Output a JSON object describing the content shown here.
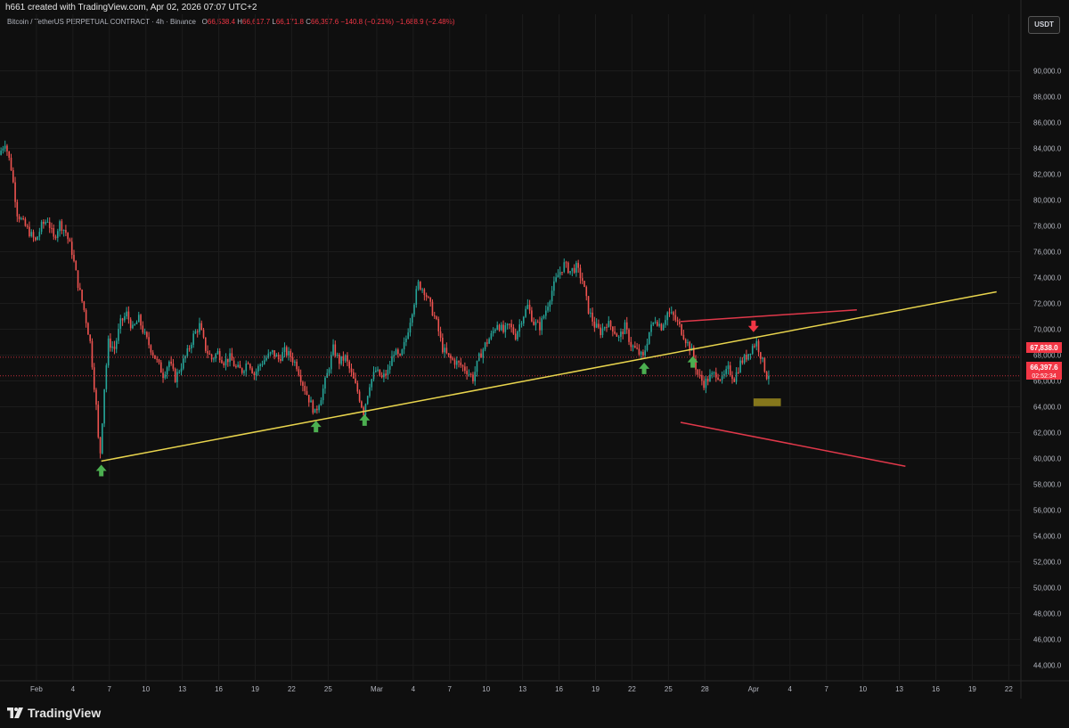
{
  "header": {
    "author_line": "h661 created with TradingView.com, Apr 02, 2026 07:07 UTC+2",
    "symbol": "Bitcoin / TetherUS PERPETUAL CONTRACT · 4h · Binance",
    "ohlc": [
      {
        "key": "O",
        "value": "66,538.4"
      },
      {
        "key": "H",
        "value": "66,617.7"
      },
      {
        "key": "L",
        "value": "66,171.8"
      },
      {
        "key": "C",
        "value": "66,397.6"
      }
    ],
    "change": "−140.8 (−0.21%)",
    "change2": "−1,688.9 (−2.48%)",
    "currency_button": "USDT"
  },
  "price_labels": {
    "level_label": "67,838.0",
    "last_price": "66,397.6",
    "countdown": "02:52:34"
  },
  "chart_data": {
    "type": "candlestick",
    "title": "Bitcoin / TetherUS PERPETUAL CONTRACT · 4h · Binance",
    "ylim": [
      42800,
      93000
    ],
    "xlim": [
      "2026-01-29",
      "2026-04-23"
    ],
    "y_ticks": [
      44000,
      46000,
      48000,
      50000,
      52000,
      54000,
      56000,
      58000,
      60000,
      62000,
      64000,
      66000,
      68000,
      70000,
      72000,
      74000,
      76000,
      78000,
      80000,
      82000,
      84000,
      86000,
      88000,
      90000
    ],
    "y_tick_labels": [
      "44,000.0",
      "46,000.0",
      "48,000.0",
      "50,000.0",
      "52,000.0",
      "54,000.0",
      "56,000.0",
      "58,000.0",
      "60,000.0",
      "62,000.0",
      "64,000.0",
      "66,000.0",
      "68,000.0",
      "70,000.0",
      "72,000.0",
      "74,000.0",
      "76,000.0",
      "78,000.0",
      "80,000.0",
      "82,000.0",
      "84,000.0",
      "86,000.0",
      "88,000.0",
      "90,000.0"
    ],
    "x_ticks": [
      {
        "date": "2026-02-01",
        "label": "Feb"
      },
      {
        "date": "2026-02-04",
        "label": "4"
      },
      {
        "date": "2026-02-07",
        "label": "7"
      },
      {
        "date": "2026-02-10",
        "label": "10"
      },
      {
        "date": "2026-02-13",
        "label": "13"
      },
      {
        "date": "2026-02-16",
        "label": "16"
      },
      {
        "date": "2026-02-19",
        "label": "19"
      },
      {
        "date": "2026-02-22",
        "label": "22"
      },
      {
        "date": "2026-02-25",
        "label": "25"
      },
      {
        "date": "2026-03-01",
        "label": "Mar"
      },
      {
        "date": "2026-03-04",
        "label": "4"
      },
      {
        "date": "2026-03-07",
        "label": "7"
      },
      {
        "date": "2026-03-10",
        "label": "10"
      },
      {
        "date": "2026-03-13",
        "label": "13"
      },
      {
        "date": "2026-03-16",
        "label": "16"
      },
      {
        "date": "2026-03-19",
        "label": "19"
      },
      {
        "date": "2026-03-22",
        "label": "22"
      },
      {
        "date": "2026-03-25",
        "label": "25"
      },
      {
        "date": "2026-03-28",
        "label": "28"
      },
      {
        "date": "2026-04-01",
        "label": "Apr"
      },
      {
        "date": "2026-04-04",
        "label": "4"
      },
      {
        "date": "2026-04-07",
        "label": "7"
      },
      {
        "date": "2026-04-10",
        "label": "10"
      },
      {
        "date": "2026-04-13",
        "label": "13"
      },
      {
        "date": "2026-04-16",
        "label": "16"
      },
      {
        "date": "2026-04-19",
        "label": "19"
      },
      {
        "date": "2026-04-22",
        "label": "22"
      }
    ],
    "price_path": [
      [
        "2026-01-29 00:00",
        83500
      ],
      [
        "2026-01-29 12:00",
        84500
      ],
      [
        "2026-01-30 00:00",
        82500
      ],
      [
        "2026-01-30 12:00",
        79000
      ],
      [
        "2026-01-31 00:00",
        78200
      ],
      [
        "2026-01-31 12:00",
        77500
      ],
      [
        "2026-02-01 00:00",
        76800
      ],
      [
        "2026-02-01 12:00",
        78000
      ],
      [
        "2026-02-02 00:00",
        78500
      ],
      [
        "2026-02-02 12:00",
        77000
      ],
      [
        "2026-02-03 00:00",
        78200
      ],
      [
        "2026-02-03 12:00",
        77500
      ],
      [
        "2026-02-04 00:00",
        76000
      ],
      [
        "2026-02-04 12:00",
        73500
      ],
      [
        "2026-02-05 00:00",
        71500
      ],
      [
        "2026-02-05 12:00",
        69000
      ],
      [
        "2026-02-06 00:00",
        64000
      ],
      [
        "2026-02-06 04:00",
        61500
      ],
      [
        "2026-02-06 08:00",
        60500
      ],
      [
        "2026-02-06 16:00",
        65500
      ],
      [
        "2026-02-07 00:00",
        69000
      ],
      [
        "2026-02-07 12:00",
        68500
      ],
      [
        "2026-02-08 00:00",
        70500
      ],
      [
        "2026-02-08 12:00",
        71200
      ],
      [
        "2026-02-09 00:00",
        70000
      ],
      [
        "2026-02-09 12:00",
        70800
      ],
      [
        "2026-02-10 00:00",
        69500
      ],
      [
        "2026-02-10 12:00",
        68500
      ],
      [
        "2026-02-11 00:00",
        67500
      ],
      [
        "2026-02-11 12:00",
        66500
      ],
      [
        "2026-02-12 00:00",
        67500
      ],
      [
        "2026-02-12 12:00",
        66200
      ],
      [
        "2026-02-13 00:00",
        67200
      ],
      [
        "2026-02-13 12:00",
        68200
      ],
      [
        "2026-02-14 00:00",
        69500
      ],
      [
        "2026-02-14 12:00",
        70300
      ],
      [
        "2026-02-15 00:00",
        68500
      ],
      [
        "2026-02-15 12:00",
        67700
      ],
      [
        "2026-02-16 00:00",
        68200
      ],
      [
        "2026-02-16 12:00",
        67500
      ],
      [
        "2026-02-17 00:00",
        67800
      ],
      [
        "2026-02-17 12:00",
        67000
      ],
      [
        "2026-02-18 00:00",
        66800
      ],
      [
        "2026-02-18 12:00",
        67600
      ],
      [
        "2026-02-19 00:00",
        66500
      ],
      [
        "2026-02-19 12:00",
        67300
      ],
      [
        "2026-02-20 00:00",
        67800
      ],
      [
        "2026-02-20 12:00",
        68200
      ],
      [
        "2026-02-21 00:00",
        67700
      ],
      [
        "2026-02-21 12:00",
        68300
      ],
      [
        "2026-02-22 00:00",
        67900
      ],
      [
        "2026-02-22 12:00",
        67200
      ],
      [
        "2026-02-23 00:00",
        65800
      ],
      [
        "2026-02-23 12:00",
        64600
      ],
      [
        "2026-02-24 00:00",
        63500
      ],
      [
        "2026-02-24 12:00",
        64800
      ],
      [
        "2026-02-25 00:00",
        66500
      ],
      [
        "2026-02-25 12:00",
        68500
      ],
      [
        "2026-02-26 00:00",
        67500
      ],
      [
        "2026-02-26 12:00",
        67800
      ],
      [
        "2026-02-27 00:00",
        66500
      ],
      [
        "2026-02-27 12:00",
        65200
      ],
      [
        "2026-02-28 00:00",
        63600
      ],
      [
        "2026-02-28 12:00",
        65800
      ],
      [
        "2026-03-01 00:00",
        66800
      ],
      [
        "2026-03-01 12:00",
        66200
      ],
      [
        "2026-03-02 00:00",
        66700
      ],
      [
        "2026-03-02 12:00",
        68300
      ],
      [
        "2026-03-03 00:00",
        67700
      ],
      [
        "2026-03-03 12:00",
        69300
      ],
      [
        "2026-03-04 00:00",
        71500
      ],
      [
        "2026-03-04 12:00",
        73500
      ],
      [
        "2026-03-05 00:00",
        73000
      ],
      [
        "2026-03-05 12:00",
        71800
      ],
      [
        "2026-03-06 00:00",
        70500
      ],
      [
        "2026-03-06 12:00",
        68500
      ],
      [
        "2026-03-07 00:00",
        67800
      ],
      [
        "2026-03-07 12:00",
        67500
      ],
      [
        "2026-03-08 00:00",
        67200
      ],
      [
        "2026-03-08 12:00",
        66800
      ],
      [
        "2026-03-09 00:00",
        66200
      ],
      [
        "2026-03-09 12:00",
        67800
      ],
      [
        "2026-03-10 00:00",
        68800
      ],
      [
        "2026-03-10 12:00",
        69500
      ],
      [
        "2026-03-11 00:00",
        70500
      ],
      [
        "2026-03-11 12:00",
        69800
      ],
      [
        "2026-03-12 00:00",
        70300
      ],
      [
        "2026-03-12 12:00",
        69500
      ],
      [
        "2026-03-13 00:00",
        70800
      ],
      [
        "2026-03-13 12:00",
        71800
      ],
      [
        "2026-03-14 00:00",
        70500
      ],
      [
        "2026-03-14 12:00",
        70200
      ],
      [
        "2026-03-15 00:00",
        71500
      ],
      [
        "2026-03-15 12:00",
        73000
      ],
      [
        "2026-03-16 00:00",
        74200
      ],
      [
        "2026-03-16 12:00",
        75000
      ],
      [
        "2026-03-17 00:00",
        74500
      ],
      [
        "2026-03-17 12:00",
        74800
      ],
      [
        "2026-03-18 00:00",
        73800
      ],
      [
        "2026-03-18 12:00",
        71500
      ],
      [
        "2026-03-19 00:00",
        70300
      ],
      [
        "2026-03-19 12:00",
        69800
      ],
      [
        "2026-03-20 00:00",
        70500
      ],
      [
        "2026-03-20 12:00",
        70100
      ],
      [
        "2026-03-21 00:00",
        69300
      ],
      [
        "2026-03-21 12:00",
        70200
      ],
      [
        "2026-03-22 00:00",
        68800
      ],
      [
        "2026-03-22 12:00",
        68300
      ],
      [
        "2026-03-23 00:00",
        67800
      ],
      [
        "2026-03-23 12:00",
        69800
      ],
      [
        "2026-03-24 00:00",
        70800
      ],
      [
        "2026-03-24 12:00",
        70200
      ],
      [
        "2026-03-25 00:00",
        71300
      ],
      [
        "2026-03-25 12:00",
        71000
      ],
      [
        "2026-03-26 00:00",
        70200
      ],
      [
        "2026-03-26 12:00",
        69200
      ],
      [
        "2026-03-27 00:00",
        68300
      ],
      [
        "2026-03-27 12:00",
        66500
      ],
      [
        "2026-03-28 00:00",
        65800
      ],
      [
        "2026-03-28 12:00",
        66300
      ],
      [
        "2026-03-29 00:00",
        66600
      ],
      [
        "2026-03-29 12:00",
        66100
      ],
      [
        "2026-03-30 00:00",
        66900
      ],
      [
        "2026-03-30 12:00",
        66200
      ],
      [
        "2026-03-31 00:00",
        67400
      ],
      [
        "2026-03-31 12:00",
        67900
      ],
      [
        "2026-04-01 00:00",
        68700
      ],
      [
        "2026-04-01 08:00",
        69000
      ],
      [
        "2026-04-01 16:00",
        68000
      ],
      [
        "2026-04-02 04:00",
        66397.6
      ]
    ],
    "trendlines": [
      {
        "name": "rising support",
        "color": "#e8d44d",
        "from": [
          "2026-02-06 08:00",
          59800
        ],
        "to": [
          "2026-04-21 00:00",
          72900
        ]
      },
      {
        "name": "upper red line",
        "color": "#e0384a",
        "from": [
          "2026-03-26 00:00",
          70600
        ],
        "to": [
          "2026-04-09 12:00",
          71500
        ]
      },
      {
        "name": "lower red line",
        "color": "#e0384a",
        "from": [
          "2026-03-26 00:00",
          62800
        ],
        "to": [
          "2026-04-13 12:00",
          59400
        ]
      }
    ],
    "horizontal_levels": [
      {
        "price": 67838.0,
        "color": "#f23645",
        "label": "67,838.0"
      },
      {
        "price": 66397.6,
        "color": "#f23645",
        "label": "66,397.6"
      }
    ],
    "target_box": {
      "from": [
        "2026-04-01 00:00",
        64050
      ],
      "to": [
        "2026-04-03 06:00",
        64650
      ],
      "color": "#9a8a1e"
    },
    "markers": [
      {
        "type": "up-arrow",
        "color": "#4caf50",
        "date": "2026-02-06 08:00",
        "price": 59800
      },
      {
        "type": "up-arrow",
        "color": "#4caf50",
        "date": "2026-02-24 00:00",
        "price": 63200
      },
      {
        "type": "up-arrow",
        "color": "#4caf50",
        "date": "2026-02-28 00:00",
        "price": 63700
      },
      {
        "type": "up-arrow",
        "color": "#4caf50",
        "date": "2026-03-23 00:00",
        "price": 67700
      },
      {
        "type": "up-arrow",
        "color": "#4caf50",
        "date": "2026-03-27 00:00",
        "price": 68200
      },
      {
        "type": "down-arrow",
        "color": "#f23645",
        "date": "2026-04-01 00:00",
        "price": 69500
      }
    ],
    "colors": {
      "up": "#26a69a",
      "down": "#ef5350",
      "grid": "#1c1c1c",
      "background": "#0f0f0f"
    }
  },
  "footer": {
    "logo_text": "TradingView"
  }
}
